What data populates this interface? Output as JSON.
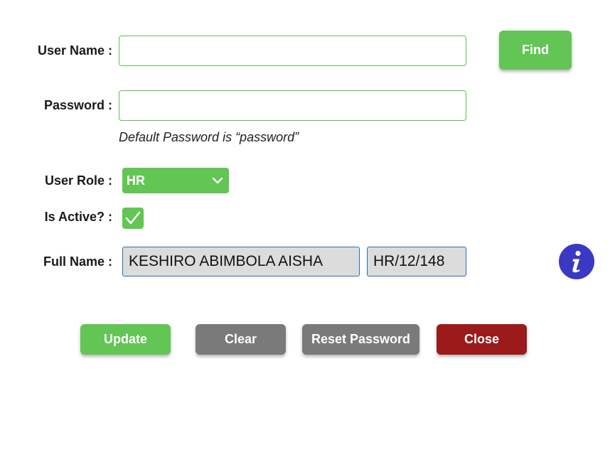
{
  "form": {
    "username": {
      "label": "User Name :",
      "value": "",
      "placeholder": ""
    },
    "password": {
      "label": "Password :",
      "value": "",
      "placeholder": "",
      "hint": "Default Password is “password”"
    },
    "role": {
      "label": "User Role :",
      "selected": "HR"
    },
    "active": {
      "label": "Is Active? :",
      "checked": true
    },
    "fullname": {
      "label": "Full Name :",
      "name": "KESHIRO ABIMBOLA AISHA",
      "id": "HR/12/148"
    }
  },
  "buttons": {
    "find": "Find",
    "update": "Update",
    "clear": "Clear",
    "reset": "Reset Password",
    "close": "Close"
  },
  "icons": {
    "info": "info-icon",
    "chevron": "chevron-down-icon",
    "check": "checkmark-icon"
  },
  "colors": {
    "green": "#62c554",
    "gray": "#7a7a7a",
    "red": "#9b1a1a",
    "info_blue": "#3b38c4",
    "input_border": "#5cc04f"
  }
}
